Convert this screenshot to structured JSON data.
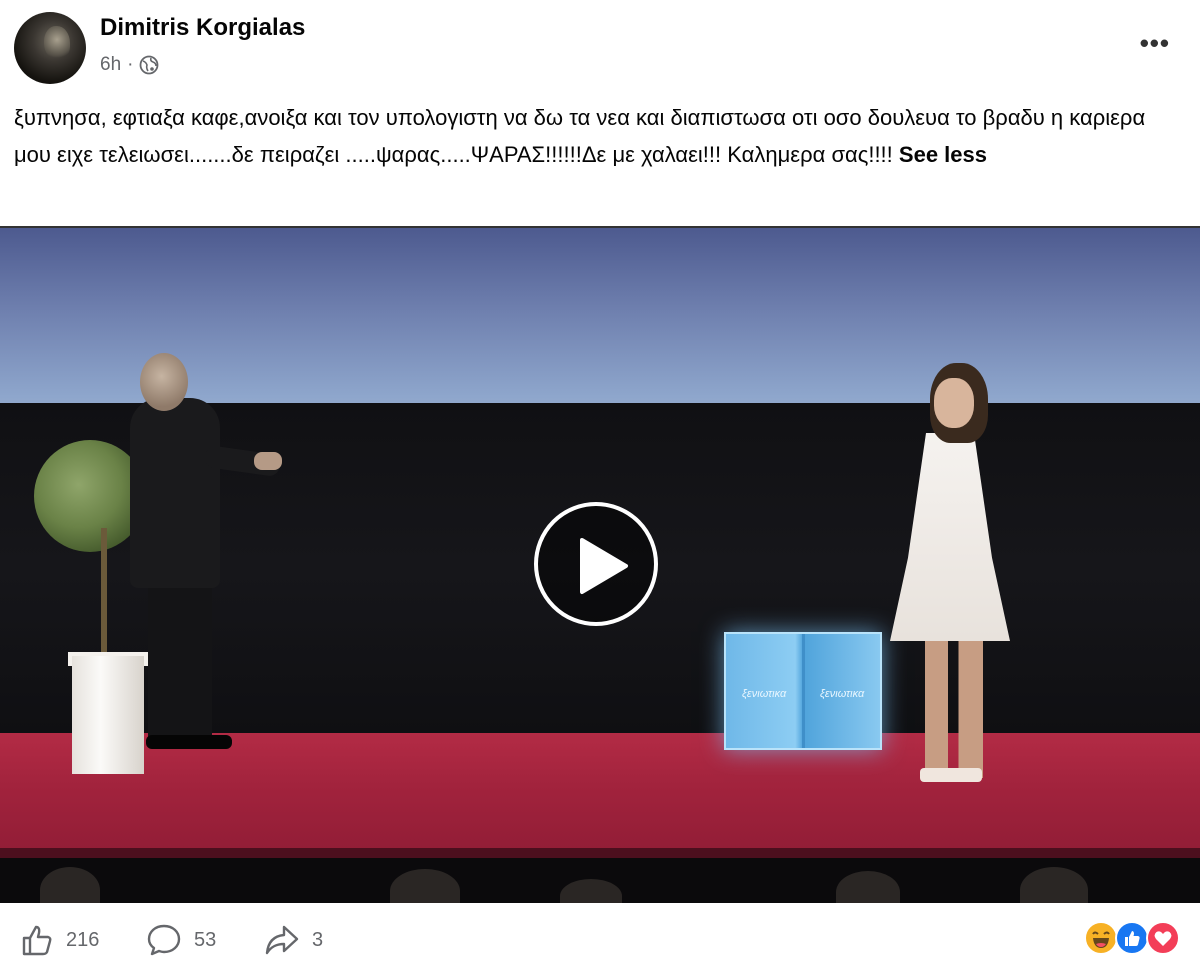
{
  "post": {
    "author": "Dimitris Korgialas",
    "time": "6h",
    "separator": "·",
    "privacy_icon": "globe-icon",
    "more_icon": "more-options-icon",
    "more_label": "•••",
    "caption_text": "ξυπνησα, εφτιαξα καφε,ανοιξα και τον υπολογιστη να δω τα νεα και  διαπιστωσα οτι οσο δουλευα το βραδυ η καριερα μου ειχε τελειωσει.......δε πειραζει .....ψαρας.....ΨΑΡΑΣ!!!!!!Δε με χαλαει!!! Καλημερα σας!!!! ",
    "see_less": "See less"
  },
  "video": {
    "play_icon": "play-icon",
    "cube_text_1": "ξενιωτικα",
    "cube_text_2": "ξενιωτικα"
  },
  "stats": {
    "likes": "216",
    "comments": "53",
    "shares": "3",
    "like_icon": "thumbs-up-icon",
    "comment_icon": "comment-icon",
    "share_icon": "share-icon"
  },
  "reactions": [
    "haha-icon",
    "like-reaction-icon",
    "love-icon"
  ],
  "colors": {
    "text": "#050505",
    "secondary": "#65676b",
    "like_blue": "#1877f2",
    "love_red": "#f33e58",
    "haha_yellow": "#f7b125"
  }
}
